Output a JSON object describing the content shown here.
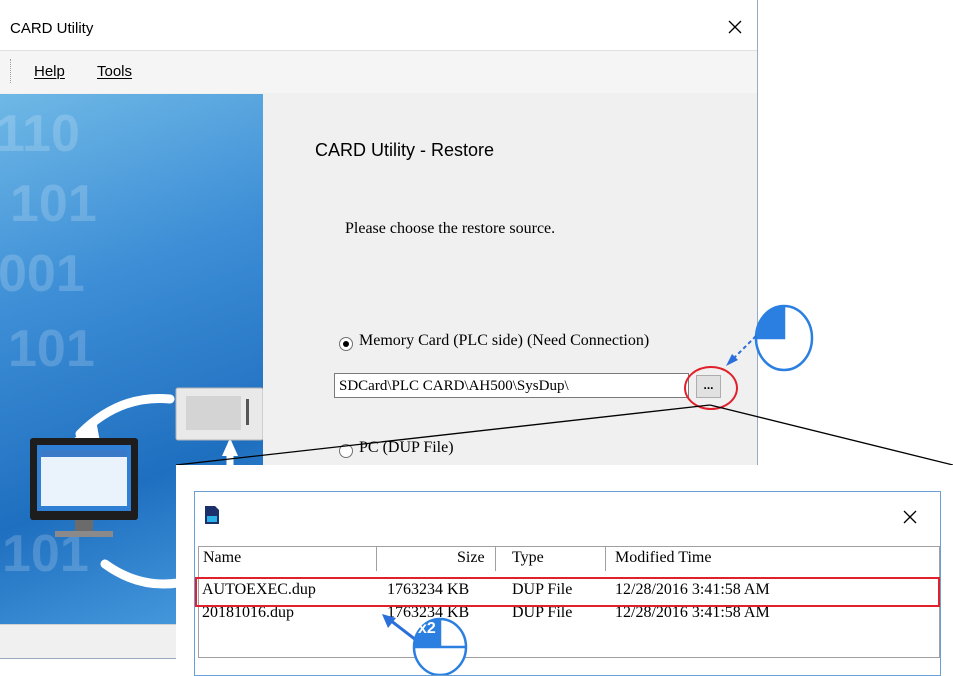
{
  "window": {
    "title": "CARD Utility",
    "menu": [
      {
        "label": "Help"
      },
      {
        "label": "Tools"
      }
    ]
  },
  "banner": {
    "binary": [
      "110",
      "101",
      "001",
      "101",
      "101"
    ]
  },
  "restore": {
    "heading": "CARD Utility - Restore",
    "prompt": "Please choose the restore source.",
    "option_memory_card": "Memory Card (PLC side) (Need Connection)",
    "option_memory_card_selected": true,
    "path_value": "SDCard\\PLC CARD\\AH500\\SysDup\\",
    "browse_label": "...",
    "option_pc": "PC (DUP File)",
    "option_pc_selected": false
  },
  "file_dialog": {
    "columns": [
      "Name",
      "Size",
      "Type",
      "Modified Time"
    ],
    "rows": [
      {
        "name": "AUTOEXEC.dup",
        "size": "1763234 KB",
        "type": "DUP File",
        "modified": "12/28/2016 3:41:58 AM",
        "highlighted": true
      },
      {
        "name": "20181016.dup",
        "size": "1763234 KB",
        "type": "DUP File",
        "modified": "12/28/2016 3:41:58 AM",
        "highlighted": false
      }
    ]
  },
  "annotations": {
    "double_click_label": "x2"
  },
  "colors": {
    "highlight": "#e0202a",
    "arrow": "#2a6fdc",
    "mouse": "#2a7fe0"
  }
}
